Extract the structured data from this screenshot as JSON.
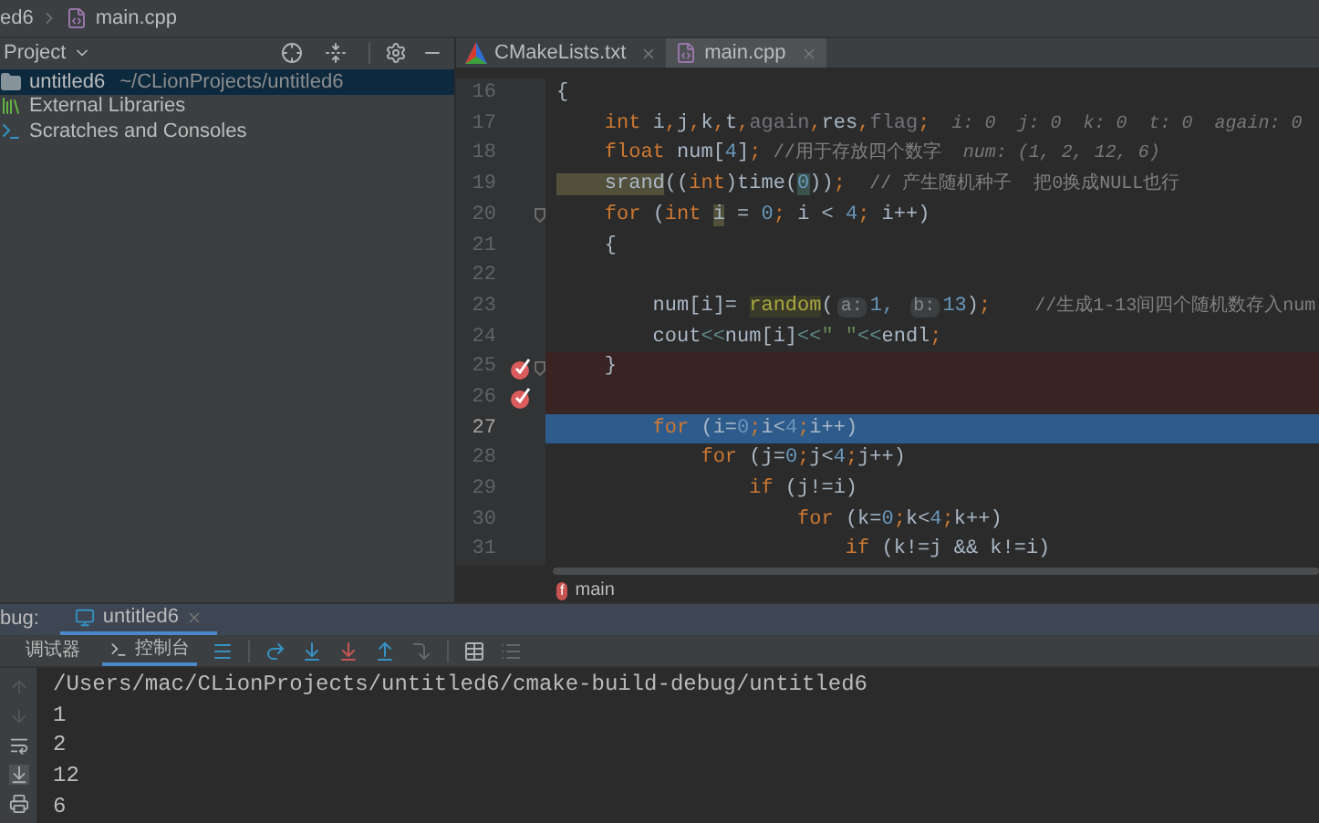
{
  "breadcrumb": [
    {
      "label": "ed6"
    },
    {
      "label": "main.cpp",
      "kind": "cpp"
    }
  ],
  "project_panel": {
    "title": "Project",
    "items": [
      {
        "label": "untitled6",
        "path": "~/CLionProjects/untitled6",
        "kind": "folder",
        "selected": true
      },
      {
        "label": "External Libraries",
        "kind": "library",
        "selected": false
      },
      {
        "label": "Scratches and Consoles",
        "kind": "scratch",
        "selected": false
      }
    ]
  },
  "editor_tabs": [
    {
      "label": "CMakeLists.txt",
      "kind": "cmake",
      "selected": false
    },
    {
      "label": "main.cpp",
      "kind": "cpp",
      "selected": true
    }
  ],
  "code_lines": [
    {
      "number": "16",
      "breakpoint": false,
      "current": false,
      "fold": false,
      "segments": [
        {
          "kind": "plain",
          "text": "{"
        }
      ]
    },
    {
      "number": "17",
      "breakpoint": false,
      "current": false,
      "fold": false,
      "segments": [
        {
          "kind": "keyword",
          "text": "    int "
        },
        {
          "kind": "plain",
          "text": "i"
        },
        {
          "kind": "keyword",
          "text": ","
        },
        {
          "kind": "plain",
          "text": "j"
        },
        {
          "kind": "keyword",
          "text": ","
        },
        {
          "kind": "plain",
          "text": "k"
        },
        {
          "kind": "keyword",
          "text": ","
        },
        {
          "kind": "plain",
          "text": "t"
        },
        {
          "kind": "keyword",
          "text": ","
        },
        {
          "kind": "unused",
          "text": "again"
        },
        {
          "kind": "keyword",
          "text": ","
        },
        {
          "kind": "plain",
          "text": "res"
        },
        {
          "kind": "keyword",
          "text": ","
        },
        {
          "kind": "unused",
          "text": "flag"
        },
        {
          "kind": "keyword",
          "text": ";"
        },
        {
          "kind": "hint",
          "text": "  i: 0  j: 0  k: 0  t: 0  again: 0"
        }
      ]
    },
    {
      "number": "18",
      "breakpoint": false,
      "current": false,
      "fold": false,
      "segments": [
        {
          "kind": "keyword",
          "text": "    float "
        },
        {
          "kind": "plain",
          "text": "num["
        },
        {
          "kind": "number",
          "text": "4"
        },
        {
          "kind": "plain",
          "text": "]"
        },
        {
          "kind": "keyword",
          "text": "; "
        },
        {
          "kind": "comment",
          "text": "//用于存放四个数字"
        },
        {
          "kind": "hint",
          "text": "  num: (1, 2, 12, 6)"
        }
      ]
    },
    {
      "number": "19",
      "breakpoint": false,
      "current": false,
      "fold": false,
      "segments": [
        {
          "kind": "func",
          "text": "    srand"
        },
        {
          "kind": "plain",
          "text": "(("
        },
        {
          "kind": "keyword",
          "text": "int"
        },
        {
          "kind": "plain",
          "text": ")time("
        },
        {
          "kind": "numhl",
          "text": "0"
        },
        {
          "kind": "plain",
          "text": "))"
        },
        {
          "kind": "keyword",
          "text": ";  "
        },
        {
          "kind": "comment",
          "text": "// 产生随机种子  把0换成NULL也行"
        }
      ]
    },
    {
      "number": "20",
      "breakpoint": false,
      "current": false,
      "fold": true,
      "segments": [
        {
          "kind": "keyword",
          "text": "    for "
        },
        {
          "kind": "plain",
          "text": "("
        },
        {
          "kind": "keyword",
          "text": "int "
        },
        {
          "kind": "varhl",
          "text": "i"
        },
        {
          "kind": "plain",
          "text": " = "
        },
        {
          "kind": "number",
          "text": "0"
        },
        {
          "kind": "keyword",
          "text": "; "
        },
        {
          "kind": "plain",
          "text": "i < "
        },
        {
          "kind": "number",
          "text": "4"
        },
        {
          "kind": "keyword",
          "text": "; "
        },
        {
          "kind": "plain",
          "text": "i++)"
        }
      ]
    },
    {
      "number": "21",
      "breakpoint": false,
      "current": false,
      "fold": false,
      "segments": [
        {
          "kind": "plain",
          "text": "    {"
        }
      ]
    },
    {
      "number": "22",
      "breakpoint": false,
      "current": false,
      "fold": false
    },
    {
      "number": "23",
      "breakpoint": false,
      "current": false,
      "fold": false,
      "segments": [
        {
          "kind": "plain",
          "text": "        num[i]= "
        },
        {
          "kind": "callhl",
          "text": "random"
        },
        {
          "kind": "plain",
          "text": "("
        },
        {
          "kind": "param",
          "text": "a:"
        },
        {
          "kind": "number",
          "text": "1, "
        },
        {
          "kind": "param",
          "text": "b:"
        },
        {
          "kind": "number",
          "text": "13"
        },
        {
          "kind": "plain",
          "text": ")"
        },
        {
          "kind": "keyword",
          "text": ";"
        },
        {
          "kind": "comment",
          "text": "    //生成1-13间四个随机数存入num"
        }
      ]
    },
    {
      "number": "24",
      "breakpoint": false,
      "current": false,
      "fold": false,
      "segments": [
        {
          "kind": "plain",
          "text": "        cout"
        },
        {
          "kind": "operator",
          "text": "<<"
        },
        {
          "kind": "plain",
          "text": "num[i]"
        },
        {
          "kind": "operator",
          "text": "<<"
        },
        {
          "kind": "string",
          "text": "\" \""
        },
        {
          "kind": "operator",
          "text": "<<"
        },
        {
          "kind": "plain",
          "text": "endl"
        },
        {
          "kind": "keyword",
          "text": ";"
        }
      ]
    },
    {
      "number": "25",
      "breakpoint": true,
      "current": false,
      "fold": true,
      "segments": [
        {
          "kind": "plain",
          "text": "    }"
        }
      ]
    },
    {
      "number": "26",
      "breakpoint": true,
      "current": false,
      "fold": false
    },
    {
      "number": "27",
      "breakpoint": false,
      "current": true,
      "fold": false,
      "segments": [
        {
          "kind": "keyword",
          "text": "        for "
        },
        {
          "kind": "plain",
          "text": "(i="
        },
        {
          "kind": "number",
          "text": "0"
        },
        {
          "kind": "keyword",
          "text": ";"
        },
        {
          "kind": "plain",
          "text": "i<"
        },
        {
          "kind": "number",
          "text": "4"
        },
        {
          "kind": "keyword",
          "text": ";"
        },
        {
          "kind": "plain",
          "text": "i++)"
        }
      ]
    },
    {
      "number": "28",
      "breakpoint": false,
      "current": false,
      "fold": false,
      "segments": [
        {
          "kind": "keyword",
          "text": "            for "
        },
        {
          "kind": "plain",
          "text": "(j="
        },
        {
          "kind": "number",
          "text": "0"
        },
        {
          "kind": "keyword",
          "text": ";"
        },
        {
          "kind": "plain",
          "text": "j<"
        },
        {
          "kind": "number",
          "text": "4"
        },
        {
          "kind": "keyword",
          "text": ";"
        },
        {
          "kind": "plain",
          "text": "j++)"
        }
      ]
    },
    {
      "number": "29",
      "breakpoint": false,
      "current": false,
      "fold": false,
      "segments": [
        {
          "kind": "keyword",
          "text": "                if "
        },
        {
          "kind": "plain",
          "text": "(j!=i)"
        }
      ]
    },
    {
      "number": "30",
      "breakpoint": false,
      "current": false,
      "fold": false,
      "segments": [
        {
          "kind": "keyword",
          "text": "                    for "
        },
        {
          "kind": "plain",
          "text": "(k="
        },
        {
          "kind": "number",
          "text": "0"
        },
        {
          "kind": "keyword",
          "text": ";"
        },
        {
          "kind": "plain",
          "text": "k<"
        },
        {
          "kind": "number",
          "text": "4"
        },
        {
          "kind": "keyword",
          "text": ";"
        },
        {
          "kind": "plain",
          "text": "k++)"
        }
      ]
    },
    {
      "number": "31",
      "breakpoint": false,
      "current": false,
      "fold": false,
      "segments": [
        {
          "kind": "keyword",
          "text": "                        if "
        },
        {
          "kind": "plain",
          "text": "(k!=j && k!=i)"
        }
      ]
    }
  ],
  "editor_breadcrumb": {
    "badge": "f",
    "label": "main"
  },
  "debug_panel": {
    "label": "bug:",
    "tabs": [
      {
        "label": "untitled6",
        "selected": true
      }
    ],
    "subtabs": [
      {
        "label": "调试器",
        "selected": false
      },
      {
        "label": "控制台",
        "selected": true
      }
    ]
  },
  "console": {
    "lines": [
      "/Users/mac/CLionProjects/untitled6/cmake-build-debug/untitled6",
      "1",
      "2",
      "12",
      "6"
    ]
  }
}
